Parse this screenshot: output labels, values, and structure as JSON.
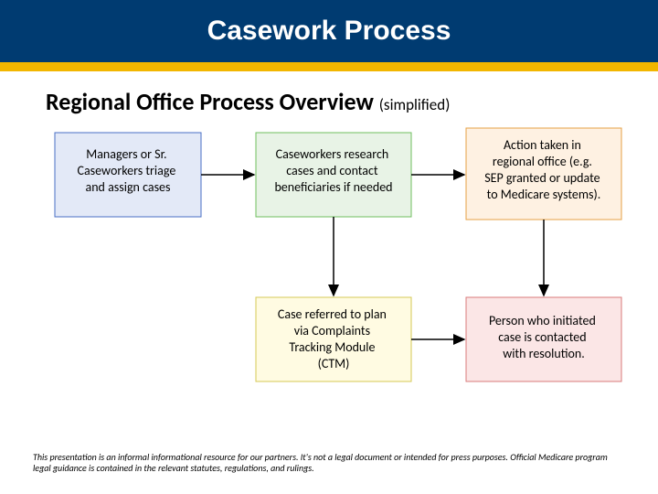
{
  "header": {
    "title": "Casework Process"
  },
  "subheading": {
    "main": "Regional Office Process Overview",
    "qualifier": "(simplified)"
  },
  "boxes": {
    "b1": {
      "line1": "Managers or Sr.",
      "line2": "Caseworkers triage",
      "line3": "and assign cases"
    },
    "b2": {
      "line1": "Caseworkers research",
      "line2": "cases and contact",
      "line3": "beneficiaries if needed"
    },
    "b3": {
      "line1": "Action taken in",
      "line2": "regional office (e.g.",
      "line3": "SEP granted or update",
      "line4": "to Medicare systems)."
    },
    "b4": {
      "line1": "Case referred to plan",
      "line2": "via Complaints",
      "line3": "Tracking Module",
      "line4": "(CTM)"
    },
    "b5": {
      "line1": "Person who initiated",
      "line2": "case is contacted",
      "line3": "with resolution."
    }
  },
  "disclaimer": "This presentation is an informal informational resource for our partners. It's not a legal document or intended for press purposes. Official Medicare program legal guidance is contained in the relevant statutes, regulations, and rulings.",
  "colors": {
    "b1_fill": "#e3e9f7",
    "b1_stroke": "#4a6fc5",
    "b2_fill": "#e8f3e6",
    "b2_stroke": "#6fbf5f",
    "b3_fill": "#fef1e2",
    "b3_stroke": "#e6a044",
    "b4_fill": "#fffbe2",
    "b4_stroke": "#d5c856",
    "b5_fill": "#fbe6e6",
    "b5_stroke": "#d97b7b"
  }
}
